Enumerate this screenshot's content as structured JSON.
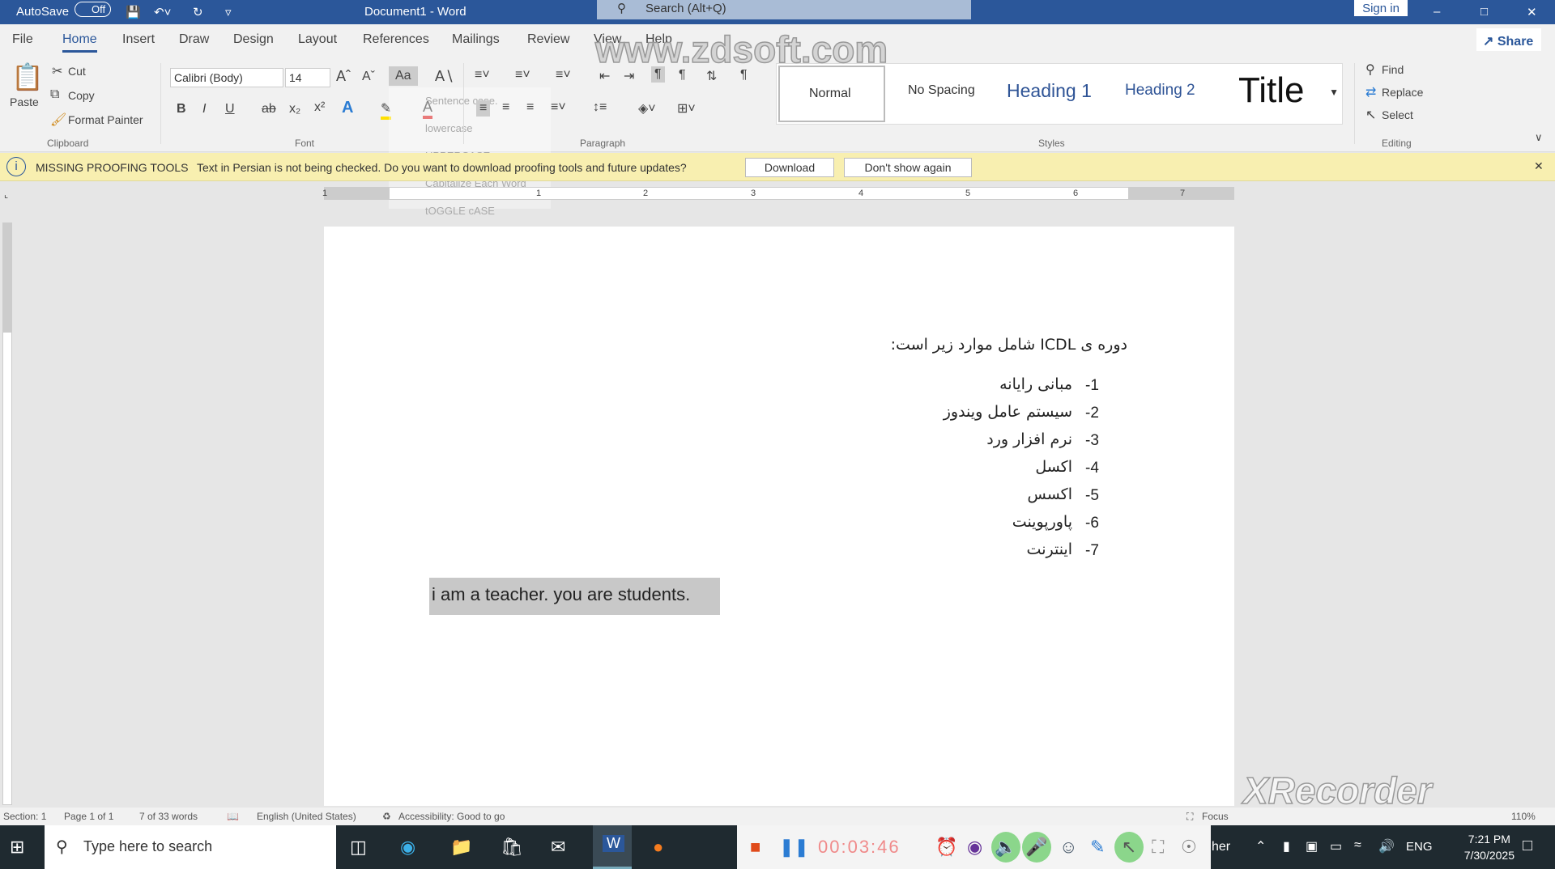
{
  "titlebar": {
    "autosave": "AutoSave",
    "autosave_state": "Off",
    "title": "Document1  -  Word",
    "search": "Search (Alt+Q)",
    "signin": "Sign in"
  },
  "tabs": [
    "File",
    "Home",
    "Insert",
    "Draw",
    "Design",
    "Layout",
    "References",
    "Mailings",
    "Review",
    "View",
    "Help"
  ],
  "share": "Share",
  "clipboard": {
    "paste": "Paste",
    "cut": "Cut",
    "copy": "Copy",
    "format_painter": "Format Painter",
    "group": "Clipboard"
  },
  "font": {
    "name": "Calibri (Body)",
    "size": "14",
    "group": "Font",
    "bold": "B",
    "italic": "I",
    "underline": "U",
    "change_case": "Aa"
  },
  "case_menu": [
    "Sentence case.",
    "lowercase",
    "UPPERCASE",
    "Capitalize Each Word",
    "tOGGLE cASE"
  ],
  "paragraph": {
    "group": "Paragraph"
  },
  "styles": {
    "group": "Styles",
    "items": [
      "Normal",
      "No Spacing",
      "Heading 1",
      "Heading 2",
      "Title"
    ]
  },
  "editing": {
    "group": "Editing",
    "find": "Find",
    "replace": "Replace",
    "select": "Select"
  },
  "infobar": {
    "title": "MISSING PROOFING TOOLS",
    "message": "Text in Persian is not being checked. Do you want to download proofing tools and future updates?",
    "download": "Download",
    "dont_show": "Don't show again"
  },
  "ruler": [
    "1",
    "1",
    "2",
    "3",
    "4",
    "5",
    "6",
    "7"
  ],
  "document": {
    "heading": "دوره ی ICDL شامل موارد زیر است:",
    "items": [
      {
        "n": "-1",
        "t": "مبانی رایانه"
      },
      {
        "n": "-2",
        "t": "سیستم عامل ویندوز"
      },
      {
        "n": "-3",
        "t": "نرم افزار ورد"
      },
      {
        "n": "-4",
        "t": "اکسل"
      },
      {
        "n": "-5",
        "t": "اکسس"
      },
      {
        "n": "-6",
        "t": "پاورپوینت"
      },
      {
        "n": "-7",
        "t": "اینترنت"
      }
    ],
    "selected_text": "i am a teacher. you are students."
  },
  "status": {
    "section": "Section: 1",
    "page": "Page 1 of 1",
    "words": "7 of 33 words",
    "language": "English (United States)",
    "accessibility": "Accessibility: Good to go",
    "focus": "Focus",
    "zoom": "110%"
  },
  "taskbar": {
    "search": "Type here to search",
    "timer": "00:03:46",
    "weather": "her",
    "lang": "ENG",
    "time": "7:21 PM",
    "date": "7/30/2025"
  },
  "watermarks": [
    "www.zdsoft.com",
    "XRecorder"
  ]
}
